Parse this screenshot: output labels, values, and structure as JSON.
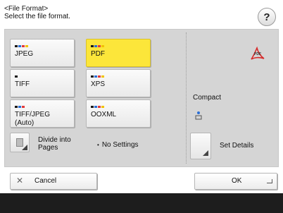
{
  "header": {
    "title": "<File Format>",
    "subtitle": "Select the file format.",
    "help_label": "?"
  },
  "formats": [
    {
      "label": "JPEG",
      "selected": false,
      "dots": [
        "#1a1a1a",
        "#2b6fd6",
        "#e23a3a",
        "#f2c200"
      ]
    },
    {
      "label": "PDF",
      "selected": true,
      "dots": [
        "#1a1a1a",
        "#2b6fd6",
        "#e23a3a",
        "#f2c200"
      ]
    },
    {
      "label": "TIFF",
      "selected": false,
      "dots": [
        "#1a1a1a"
      ]
    },
    {
      "label": "XPS",
      "selected": false,
      "dots": [
        "#1a1a1a",
        "#2b6fd6",
        "#e23a3a",
        "#f2c200"
      ]
    },
    {
      "label_line1": "TIFF/JPEG",
      "label_line2": "(Auto)",
      "selected": false,
      "dots": [
        "#1a1a1a",
        "#2b6fd6",
        "#e23a3a"
      ]
    },
    {
      "label": "OOXML",
      "selected": false,
      "dots": [
        "#1a1a1a",
        "#2b6fd6",
        "#e23a3a",
        "#f2c200"
      ]
    }
  ],
  "divide": {
    "label_line1": "Divide into",
    "label_line2": "Pages",
    "status": "No Settings",
    "icon": "document-icon"
  },
  "right_panel": {
    "compact_label": "Compact",
    "adobe_icon": "adobe-pdf-icon",
    "compact_icon": "compact-icon",
    "set_details_label": "Set Details"
  },
  "footer": {
    "cancel_label": "Cancel",
    "cancel_icon": "close-icon",
    "ok_label": "OK",
    "ok_icon": "enter-icon"
  },
  "colors": {
    "selected_accent": "#fce63a",
    "panel_bg": "#d5d5d5",
    "bottom_bar": "#1d1d1d"
  }
}
